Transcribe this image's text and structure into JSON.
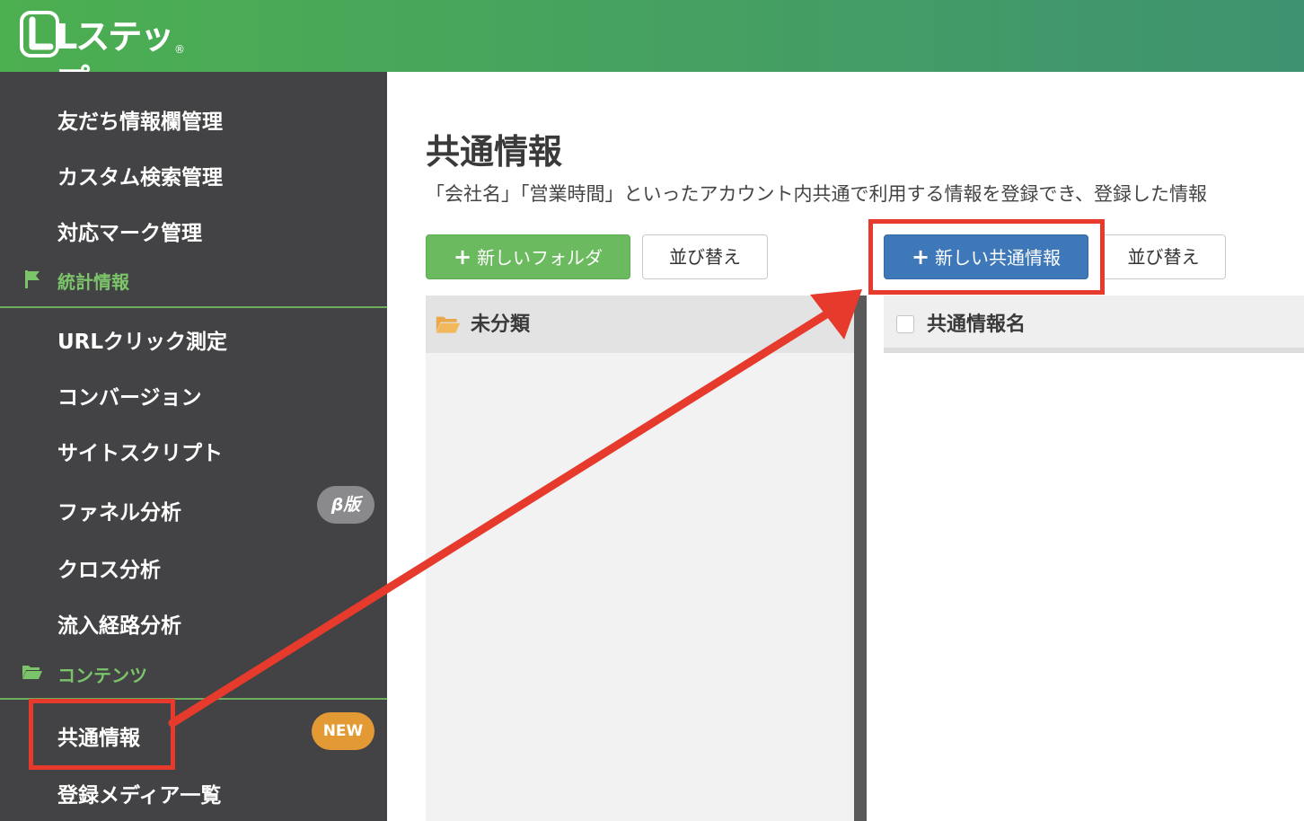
{
  "header": {
    "logo_text": "Lステップ",
    "logo_reg": "®"
  },
  "sidebar": {
    "items_top": [
      {
        "label": "友だち情報欄管理"
      },
      {
        "label": "カスタム検索管理"
      },
      {
        "label": "対応マーク管理"
      }
    ],
    "section_stats": {
      "label": "統計情報",
      "icon": "flag-icon"
    },
    "items_stats": [
      {
        "label": "URLクリック測定"
      },
      {
        "label": "コンバージョン"
      },
      {
        "label": "サイトスクリプト"
      },
      {
        "label": "ファネル分析",
        "badge": "β版"
      },
      {
        "label": "クロス分析"
      },
      {
        "label": "流入経路分析"
      }
    ],
    "section_contents": {
      "label": "コンテンツ",
      "icon": "folder-open-icon"
    },
    "items_contents": [
      {
        "label": "共通情報",
        "badge": "NEW"
      },
      {
        "label": "登録メディア一覧"
      }
    ]
  },
  "main": {
    "title": "共通情報",
    "description": "「会社名」「営業時間」といったアカウント内共通で利用する情報を登録でき、登録した情報",
    "buttons": {
      "new_folder": "新しいフォルダ",
      "sort_folders": "並び替え",
      "new_common_info": "新しい共通情報",
      "sort_items": "並び替え"
    },
    "folders": [
      {
        "label": "未分類",
        "icon": "folder-open-icon"
      }
    ],
    "list": {
      "column_header": "共通情報名"
    }
  },
  "colors": {
    "header_green": "#4caf50",
    "sidebar_bg": "#434345",
    "section_green": "#7bc46a",
    "annotation_red": "#e53a2c",
    "primary_blue": "#3f78b8",
    "badge_new": "#e39a34"
  }
}
